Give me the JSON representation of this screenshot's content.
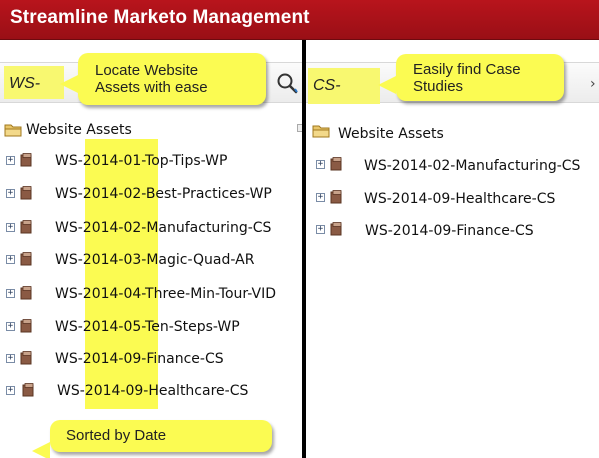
{
  "header": {
    "title": "Streamline Marketo Management",
    "bg": "#a8121a"
  },
  "left_panel": {
    "search_value": "WS-",
    "callout": [
      "Locate Website",
      "Assets with ease"
    ],
    "root": "Website Assets",
    "items": [
      "WS-2014-01-Top-Tips-WP",
      "WS-2014-02-Best-Practices-WP",
      "WS-2014-02-Manufacturing-CS",
      "WS-2014-03-Magic-Quad-AR",
      "WS-2014-04-Three-Min-Tour-VID",
      "WS-2014-05-Ten-Steps-WP",
      "WS-2014-09-Finance-CS",
      "WS-2014-09-Healthcare-CS"
    ],
    "date_callout": "Sorted by Date"
  },
  "right_panel": {
    "search_value": "CS-",
    "callout": [
      "Easily find Case",
      "Studies"
    ],
    "root": "Website Assets",
    "items": [
      "WS-2014-02-Manufacturing-CS",
      "WS-2014-09-Healthcare-CS",
      "WS-2014-09-Finance-CS"
    ]
  },
  "icons": [
    "folder-icon",
    "expand-icon",
    "asset-icon",
    "search-icon",
    "arrow-icon"
  ],
  "colors": {
    "highlight": "#fbfb52",
    "header": "#a8121a",
    "divider": "#000000"
  }
}
